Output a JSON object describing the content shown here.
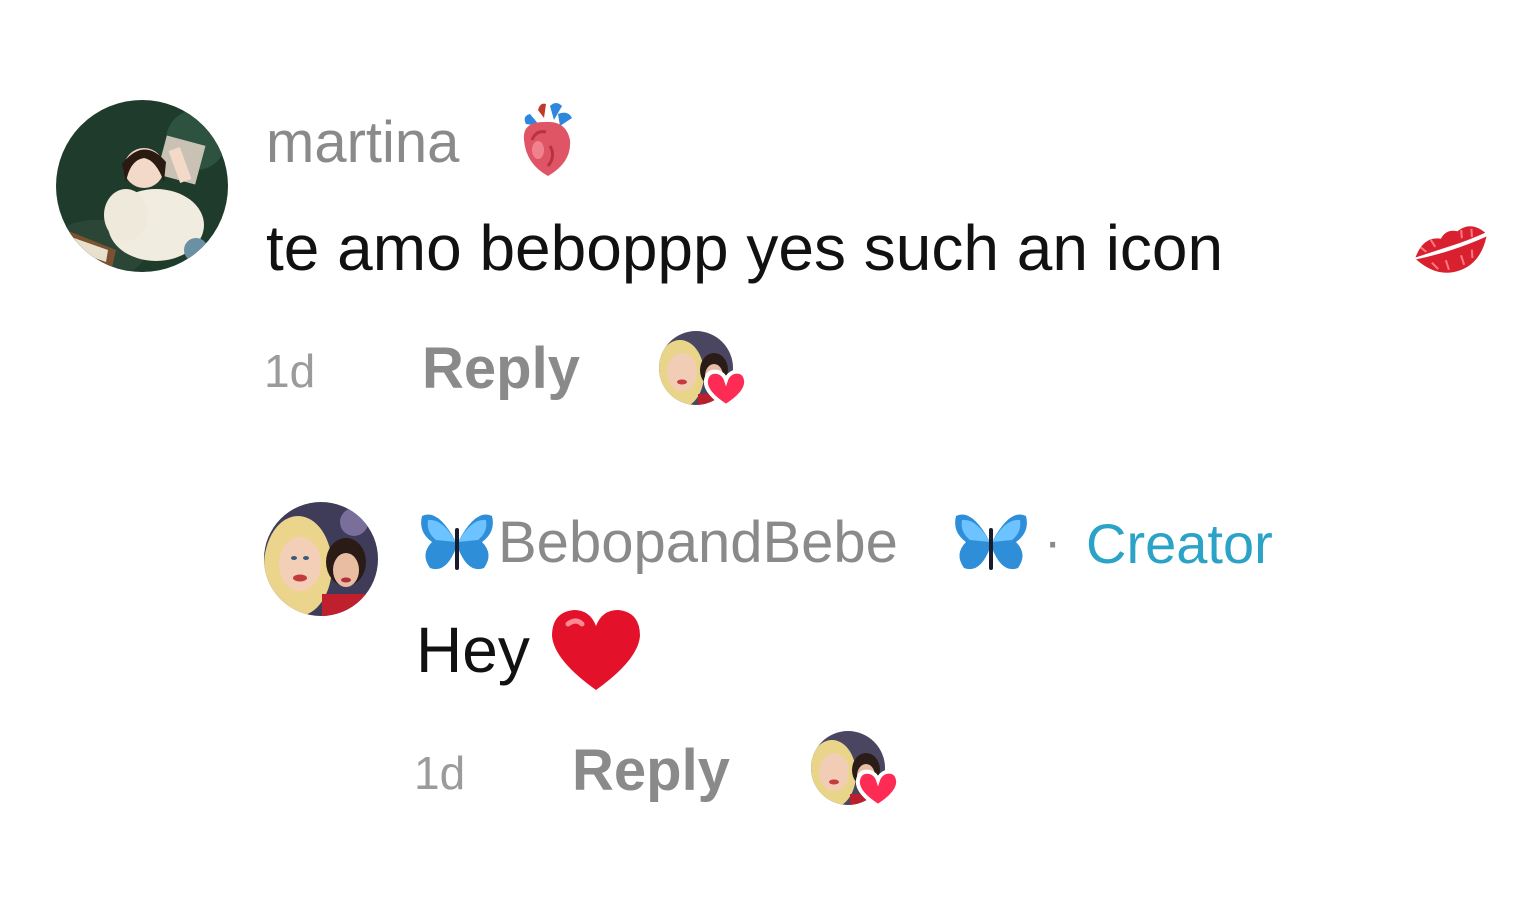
{
  "comments": [
    {
      "username": "martina",
      "username_emoji_icon": "anatomical-heart-icon",
      "text": "te amo beboppp yes such an icon",
      "text_emoji_icon": "kiss-mark-icon",
      "time": "1d",
      "reply_label": "Reply",
      "liked_by_creator_icon": "creator-heart-avatar-icon"
    },
    {
      "username": "BebopandBebe",
      "username_prefix_icon": "butterfly-icon",
      "username_suffix_icon": "butterfly-icon",
      "separator": "·",
      "badge": "Creator",
      "text": "Hey",
      "text_emoji_icon": "red-heart-icon",
      "time": "1d",
      "reply_label": "Reply",
      "liked_by_creator_icon": "creator-heart-avatar-icon"
    }
  ],
  "colors": {
    "username": "#8a8a8a",
    "comment_text": "#111111",
    "creator_badge": "#2aa3c6",
    "like_heart": "#fe2c55",
    "butterfly": "#2e8fd8"
  }
}
